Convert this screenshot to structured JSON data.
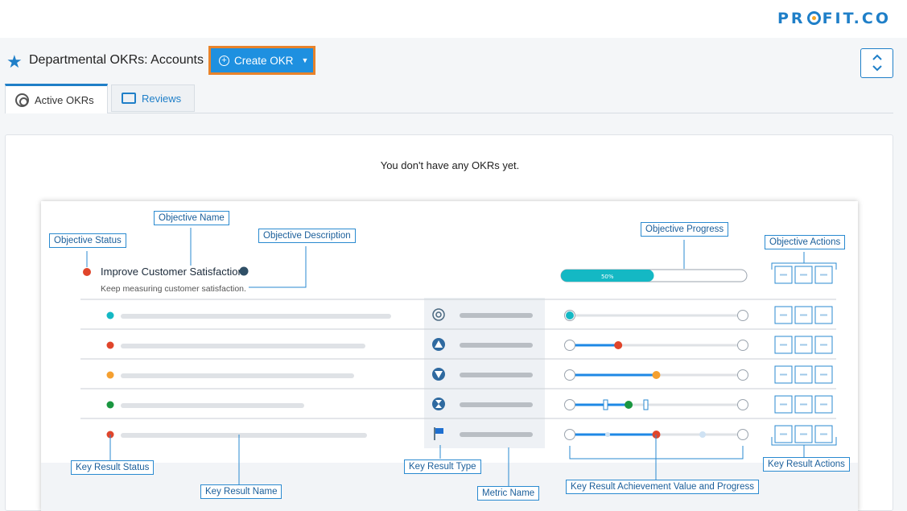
{
  "brand": {
    "pre": "PR",
    "post": "FIT.CO"
  },
  "header": {
    "title": "Departmental OKRs: Accounts",
    "create_label": "Create OKR"
  },
  "tabs": [
    {
      "label": "Active OKRs"
    },
    {
      "label": "Reviews"
    }
  ],
  "empty_message": "You don't have any OKRs yet.",
  "illustration": {
    "objective_name": "Improve Customer Satisfaction",
    "objective_description": "Keep measuring customer satisfaction.",
    "objective_progress": "50%",
    "objective_progress_value": 0.5,
    "labels": {
      "objective_status": "Objective Status",
      "objective_name": "Objective Name",
      "objective_description": "Objective Description",
      "objective_progress": "Objective Progress",
      "objective_actions": "Objective Actions",
      "key_result_status": "Key Result Status",
      "key_result_name": "Key Result Name",
      "key_result_type": "Key Result Type",
      "metric_name": "Metric Name",
      "key_result_achievement": "Key Result Achievement Value and Progress",
      "key_result_actions": "Key Result Actions"
    },
    "key_results": [
      {
        "status_color": "#14b8c4",
        "progress": 0.0
      },
      {
        "status_color": "#e0452b",
        "progress": 0.28
      },
      {
        "status_color": "#f5a030",
        "progress": 0.5
      },
      {
        "status_color": "#1a9640",
        "progress": 0.34
      },
      {
        "status_color": "#e0452b",
        "progress": 0.5
      }
    ]
  },
  "colors": {
    "accent": "#1f7fc8",
    "button": "#1e90e0",
    "highlight": "#e8832b",
    "teal": "#14b8c4"
  }
}
